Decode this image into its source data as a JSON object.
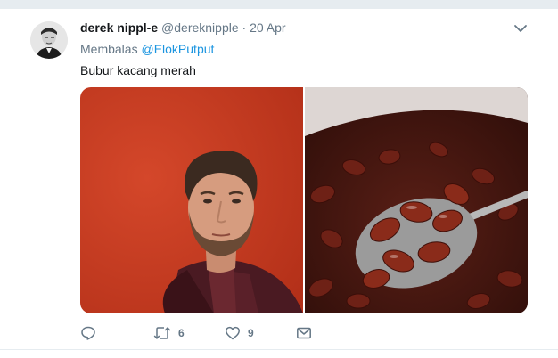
{
  "tweet": {
    "display_name": "derek nippl-e",
    "handle": "@dereknipple",
    "separator": "·",
    "date": "20 Apr",
    "reply_prefix": "Membalas",
    "reply_to": "@ElokPutput",
    "text": "Bubur kacang merah",
    "media": [
      {
        "name": "portrait-photo",
        "bg": "#c8391e"
      },
      {
        "name": "red-bean-porridge-photo",
        "bg": "#3b1712"
      }
    ]
  },
  "actions": {
    "reply": {
      "icon": "reply-icon",
      "count": ""
    },
    "retweet": {
      "icon": "retweet-icon",
      "count": "6"
    },
    "like": {
      "icon": "heart-icon",
      "count": "9"
    },
    "message": {
      "icon": "envelope-icon",
      "count": ""
    }
  },
  "colors": {
    "link": "#1b95e0",
    "muted": "#657786",
    "text": "#14171a",
    "divider": "#e6ecf0"
  }
}
